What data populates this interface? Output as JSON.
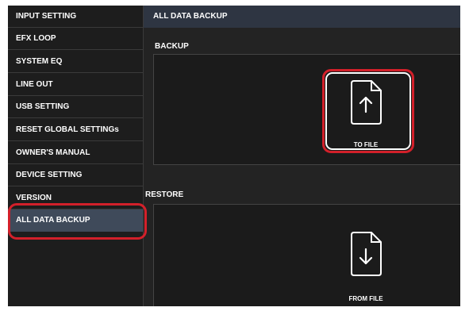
{
  "sidebar": {
    "items": [
      {
        "label": "INPUT SETTING"
      },
      {
        "label": "EFX LOOP"
      },
      {
        "label": "SYSTEM EQ"
      },
      {
        "label": "LINE OUT"
      },
      {
        "label": "USB SETTING"
      },
      {
        "label": "RESET GLOBAL SETTINGs"
      },
      {
        "label": "OWNER'S MANUAL"
      },
      {
        "label": "DEVICE SETTING"
      },
      {
        "label": "VERSION"
      },
      {
        "label": "ALL DATA BACKUP",
        "selected": true
      }
    ]
  },
  "main": {
    "title": "ALL DATA BACKUP",
    "backup": {
      "section_label": "BACKUP",
      "button_label": "TO FILE",
      "icon": "upload-file-icon"
    },
    "restore": {
      "section_label": "RESTORE",
      "button_label": "FROM FILE",
      "icon": "download-file-icon"
    }
  },
  "colors": {
    "highlight": "#d3202a",
    "header": "#2e3542",
    "selected": "#3f4a5a",
    "background": "#232323"
  }
}
